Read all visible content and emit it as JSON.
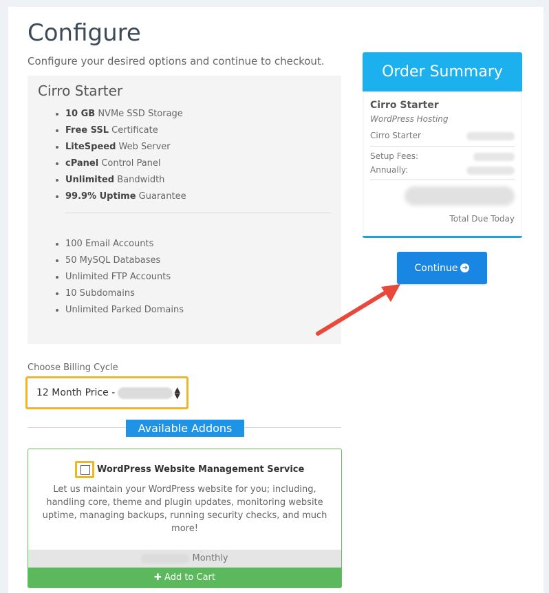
{
  "page": {
    "title": "Configure",
    "subtitle": "Configure your desired options and continue to checkout."
  },
  "product": {
    "name": "Cirro Starter",
    "features": [
      {
        "bold": "10 GB",
        "text": " NVMe SSD Storage"
      },
      {
        "bold": "Free SSL",
        "text": " Certificate"
      },
      {
        "bold": "LiteSpeed",
        "text": " Web Server"
      },
      {
        "bold": "cPanel",
        "text": " Control Panel"
      },
      {
        "bold": "Unlimited",
        "text": " Bandwidth"
      },
      {
        "bold": "99.9% Uptime",
        "text": " Guarantee"
      }
    ],
    "extras": [
      "100 Email Accounts",
      "50 MySQL Databases",
      "Unlimited FTP Accounts",
      "10 Subdomains",
      "Unlimited Parked Domains"
    ]
  },
  "billing": {
    "label": "Choose Billing Cycle",
    "selected": "12 Month Price -"
  },
  "addons": {
    "heading": "Available Addons",
    "items": [
      {
        "title": "WordPress Website Management Service",
        "description": "Let us maintain your WordPress website for you; including, handling core, theme and plugin updates, monitoring website uptime, managing backups, running security checks, and much more!",
        "period": "Monthly",
        "cart_label": "Add to Cart",
        "checked": false
      }
    ]
  },
  "summary": {
    "title": "Order Summary",
    "product_name": "Cirro Starter",
    "product_group": "WordPress Hosting",
    "line_item_label": "Cirro Starter",
    "setup_fees_label": "Setup Fees:",
    "annually_label": "Annually:",
    "total_label": "Total Due Today"
  },
  "actions": {
    "continue_label": "Continue"
  },
  "colors": {
    "accent_blue": "#1a86e4",
    "summary_header": "#1cb0ee",
    "addon_green": "#5cb85c",
    "highlight_yellow": "#f0b429",
    "annotation_red": "#e8493a"
  },
  "icons": {
    "continue": "arrow-circle-right-icon",
    "cart": "plus-icon",
    "select": "sort-arrows-icon"
  }
}
